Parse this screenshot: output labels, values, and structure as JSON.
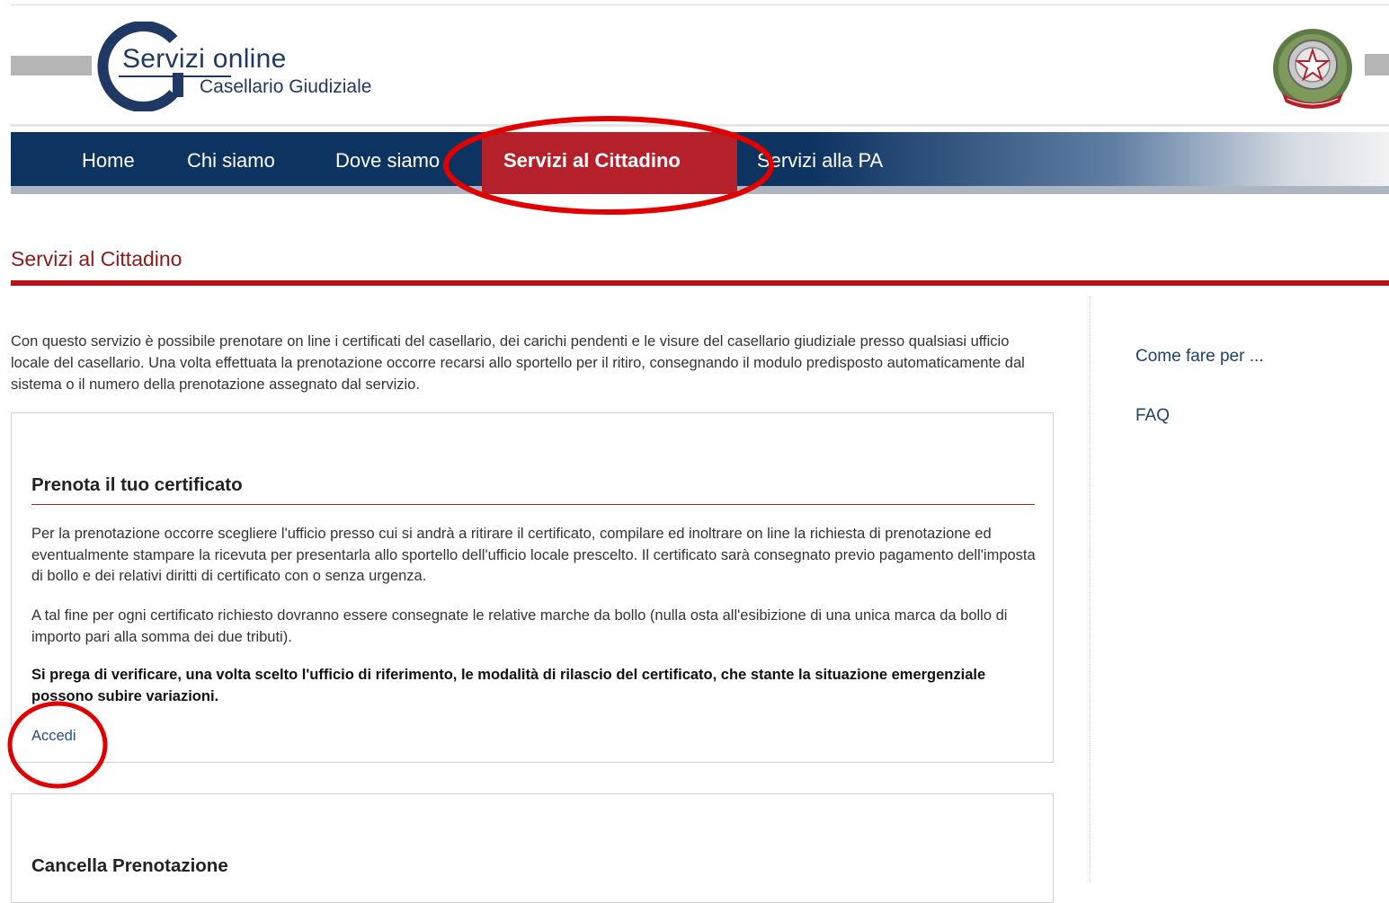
{
  "header": {
    "logo_title": "Servizi online",
    "logo_subtitle": "Casellario Giudiziale"
  },
  "nav": {
    "items": [
      {
        "label": "Home"
      },
      {
        "label": "Chi siamo"
      },
      {
        "label": "Dove siamo"
      },
      {
        "label": "Servizi al Cittadino",
        "active": true
      },
      {
        "label": "Servizi alla PA"
      }
    ]
  },
  "page": {
    "title": "Servizi al Cittadino",
    "intro": "Con questo servizio è possibile prenotare on line i certificati del casellario, dei carichi pendenti e le visure del casellario giudiziale presso qualsiasi ufficio locale del casellario. Una volta effettuata la prenotazione occorre recarsi allo sportello per il ritiro, consegnando il modulo predisposto automaticamente dal sistema o il numero della prenotazione assegnato dal servizio."
  },
  "panels": [
    {
      "title": "Prenota il tuo certificato",
      "paragraph1": "Per la prenotazione occorre scegliere l'ufficio presso cui si andrà a ritirare il certificato, compilare ed inoltrare on line la richiesta di prenotazione ed eventualmente stampare la ricevuta per presentarla allo sportello dell'ufficio locale prescelto. Il certificato sarà consegnato previo pagamento dell'imposta di bollo e dei relativi diritti di certificato con o senza  urgenza.",
      "paragraph2": "A tal fine per ogni certificato richiesto dovranno essere consegnate  le relative marche da bollo (nulla osta all'esibizione di una unica marca da bollo di importo pari alla somma dei due tributi).",
      "notice": "Si prega di verificare, una volta scelto l'ufficio di riferimento, le modalità di rilascio del certificato, che stante la situazione emergenziale possono subire variazioni.",
      "link": "Accedi"
    },
    {
      "title": "Cancella Prenotazione"
    }
  ],
  "sidebar": {
    "links": [
      {
        "label": "Come fare per ..."
      },
      {
        "label": "FAQ"
      }
    ]
  },
  "colors": {
    "nav_blue": "#0d3360",
    "active_red": "#b5212b",
    "title_red": "#8b1a1a",
    "link_blue": "#1f4e8c",
    "annotation_red": "#e00000"
  },
  "icons": {
    "logo": "servizi-online-g-logo",
    "emblem": "repubblica-italiana-emblem"
  }
}
